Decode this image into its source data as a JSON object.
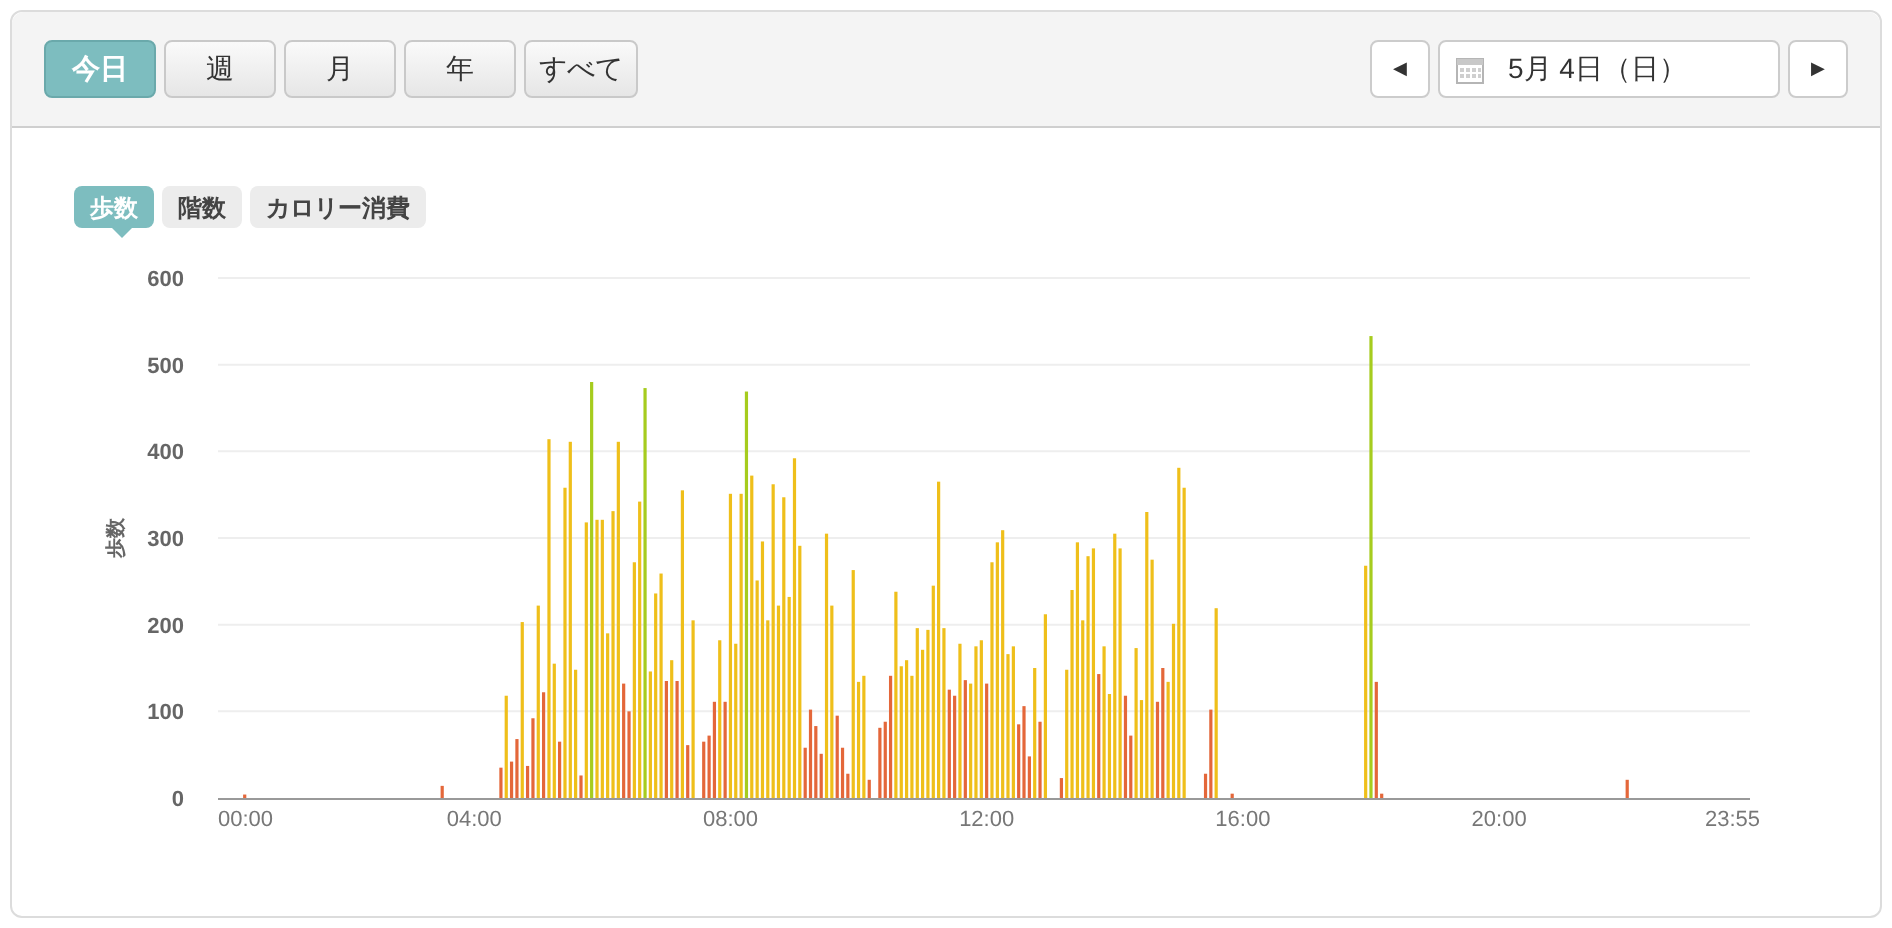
{
  "period_tabs": [
    {
      "label": "今日",
      "selected": true
    },
    {
      "label": "週",
      "selected": false
    },
    {
      "label": "月",
      "selected": false
    },
    {
      "label": "年",
      "selected": false
    },
    {
      "label": "すべて",
      "selected": false
    }
  ],
  "date_nav": {
    "prev": "◀",
    "date": "5月 4日（日）",
    "next": "▶"
  },
  "metric_tabs": [
    {
      "label": "歩数",
      "selected": true
    },
    {
      "label": "階数",
      "selected": false
    },
    {
      "label": "カロリー消費",
      "selected": false
    }
  ],
  "chart": {
    "chart_data": {
      "type": "bar",
      "grid": true,
      "ylabel": "歩数",
      "xlim": [
        0,
        23.917
      ],
      "ylim": [
        0,
        600
      ],
      "yticks": [
        0,
        100,
        200,
        300,
        400,
        500,
        600
      ],
      "xticks": [
        {
          "value": 0,
          "label": "00:00"
        },
        {
          "value": 4,
          "label": "04:00"
        },
        {
          "value": 8,
          "label": "08:00"
        },
        {
          "value": 12,
          "label": "12:00"
        },
        {
          "value": 16,
          "label": "16:00"
        },
        {
          "value": 20,
          "label": "20:00"
        },
        {
          "value": 23.917,
          "label": "23:55"
        }
      ],
      "x": [
        0.417,
        3.5,
        4.417,
        4.5,
        4.583,
        4.667,
        4.75,
        4.833,
        4.917,
        5,
        5.083,
        5.167,
        5.25,
        5.333,
        5.417,
        5.5,
        5.583,
        5.667,
        5.75,
        5.833,
        5.917,
        6,
        6.083,
        6.167,
        6.25,
        6.333,
        6.417,
        6.5,
        6.583,
        6.667,
        6.75,
        6.833,
        6.917,
        7,
        7.083,
        7.167,
        7.25,
        7.333,
        7.417,
        7.583,
        7.667,
        7.75,
        7.833,
        7.917,
        8,
        8.083,
        8.167,
        8.25,
        8.333,
        8.417,
        8.5,
        8.583,
        8.667,
        8.75,
        8.833,
        8.917,
        9,
        9.083,
        9.167,
        9.25,
        9.333,
        9.417,
        9.5,
        9.583,
        9.667,
        9.75,
        9.833,
        9.917,
        10,
        10.083,
        10.167,
        10.333,
        10.417,
        10.5,
        10.583,
        10.667,
        10.75,
        10.833,
        10.917,
        11,
        11.083,
        11.167,
        11.25,
        11.333,
        11.417,
        11.5,
        11.583,
        11.667,
        11.75,
        11.833,
        11.917,
        12,
        12.083,
        12.167,
        12.25,
        12.333,
        12.417,
        12.5,
        12.583,
        12.667,
        12.75,
        12.833,
        12.917,
        13.167,
        13.25,
        13.333,
        13.417,
        13.5,
        13.583,
        13.667,
        13.75,
        13.833,
        13.917,
        14,
        14.083,
        14.167,
        14.25,
        14.333,
        14.417,
        14.5,
        14.583,
        14.667,
        14.75,
        14.833,
        14.917,
        15,
        15.083,
        15.417,
        15.5,
        15.583,
        15.833,
        17.917,
        18,
        18.083,
        18.167,
        22
      ],
      "series": [
        {
          "color": "#e4673a",
          "values": [
            4,
            14,
            35,
            null,
            42,
            68,
            null,
            37,
            92,
            null,
            122,
            null,
            null,
            65,
            null,
            null,
            null,
            26,
            null,
            null,
            null,
            null,
            null,
            null,
            null,
            132,
            100,
            null,
            null,
            null,
            null,
            null,
            null,
            135,
            null,
            135,
            null,
            61,
            null,
            65,
            72,
            111,
            null,
            111,
            null,
            null,
            null,
            null,
            null,
            null,
            null,
            null,
            null,
            null,
            null,
            null,
            null,
            null,
            58,
            102,
            83,
            51,
            null,
            null,
            95,
            58,
            28,
            null,
            null,
            null,
            21,
            81,
            88,
            141,
            null,
            null,
            null,
            null,
            null,
            null,
            null,
            null,
            null,
            null,
            125,
            118,
            null,
            136,
            null,
            null,
            null,
            132,
            null,
            null,
            null,
            null,
            null,
            85,
            106,
            48,
            null,
            88,
            null,
            23,
            null,
            null,
            null,
            null,
            null,
            null,
            143,
            null,
            null,
            null,
            null,
            118,
            72,
            null,
            null,
            null,
            null,
            111,
            150,
            null,
            null,
            null,
            null,
            28,
            102,
            null,
            5,
            null,
            null,
            134,
            5,
            21
          ]
        },
        {
          "color": "#efbf1a",
          "values": [
            null,
            null,
            null,
            118,
            null,
            null,
            203,
            null,
            null,
            222,
            null,
            414,
            155,
            null,
            358,
            411,
            148,
            null,
            318,
            null,
            321,
            321,
            190,
            331,
            411,
            null,
            null,
            272,
            342,
            null,
            146,
            236,
            259,
            null,
            159,
            null,
            355,
            null,
            205,
            null,
            null,
            null,
            182,
            null,
            351,
            178,
            351,
            null,
            372,
            251,
            296,
            205,
            362,
            222,
            347,
            232,
            392,
            291,
            null,
            null,
            null,
            null,
            305,
            222,
            null,
            null,
            null,
            263,
            134,
            141,
            null,
            null,
            null,
            null,
            238,
            152,
            159,
            141,
            196,
            171,
            194,
            245,
            365,
            196,
            null,
            null,
            178,
            null,
            132,
            175,
            182,
            null,
            272,
            295,
            309,
            166,
            175,
            null,
            null,
            null,
            150,
            null,
            212,
            null,
            148,
            240,
            295,
            205,
            279,
            288,
            null,
            175,
            120,
            305,
            288,
            null,
            null,
            173,
            113,
            330,
            275,
            null,
            null,
            134,
            201,
            381,
            358,
            null,
            null,
            219,
            null,
            268,
            null,
            null,
            null,
            null
          ]
        },
        {
          "color": "#a6cc1e",
          "values": [
            null,
            null,
            null,
            null,
            null,
            null,
            null,
            null,
            null,
            null,
            null,
            null,
            null,
            null,
            null,
            null,
            null,
            null,
            null,
            480,
            null,
            null,
            null,
            null,
            null,
            null,
            null,
            null,
            null,
            473,
            null,
            null,
            null,
            null,
            null,
            null,
            null,
            null,
            null,
            null,
            null,
            null,
            null,
            null,
            null,
            null,
            null,
            469,
            null,
            null,
            null,
            null,
            null,
            null,
            null,
            null,
            null,
            null,
            null,
            null,
            null,
            null,
            null,
            null,
            null,
            null,
            null,
            null,
            null,
            null,
            null,
            null,
            null,
            null,
            null,
            null,
            null,
            null,
            null,
            null,
            null,
            null,
            null,
            null,
            null,
            null,
            null,
            null,
            null,
            null,
            null,
            null,
            null,
            null,
            null,
            null,
            null,
            null,
            null,
            null,
            null,
            null,
            null,
            null,
            null,
            null,
            null,
            null,
            null,
            null,
            null,
            null,
            null,
            null,
            null,
            null,
            null,
            null,
            null,
            null,
            null,
            null,
            null,
            null,
            null,
            null,
            null,
            null,
            null,
            null,
            null,
            null,
            533,
            null,
            null,
            null
          ]
        }
      ]
    }
  }
}
